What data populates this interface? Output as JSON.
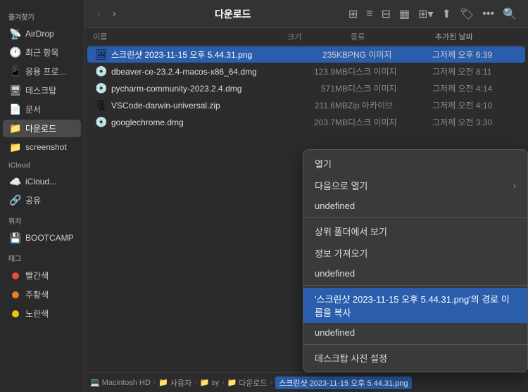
{
  "window": {
    "title": "다운로드"
  },
  "sidebar": {
    "favorites_label": "즐겨찾기",
    "items": [
      {
        "id": "airdrop",
        "label": "AirDrop",
        "icon": "📡"
      },
      {
        "id": "recent",
        "label": "최근 항목",
        "icon": "🕐"
      },
      {
        "id": "apps",
        "label": "응용 프로그램",
        "icon": "📱"
      },
      {
        "id": "desktop",
        "label": "데스크탑",
        "icon": "🖥"
      },
      {
        "id": "documents",
        "label": "문서",
        "icon": "📄"
      },
      {
        "id": "downloads",
        "label": "다운로드",
        "icon": "📁",
        "active": true
      },
      {
        "id": "screenshot",
        "label": "screenshot",
        "icon": "📁"
      }
    ],
    "icloud_label": "iCloud",
    "icloud_items": [
      {
        "id": "icloud-drive",
        "label": "iCloud...",
        "icon": "☁️"
      },
      {
        "id": "shared",
        "label": "공유",
        "icon": "🔗"
      }
    ],
    "locations_label": "위치",
    "location_items": [
      {
        "id": "bootcamp",
        "label": "BOOTCAMP",
        "icon": "💾"
      }
    ],
    "tags_label": "태그",
    "tag_items": [
      {
        "id": "red",
        "label": "빨간색",
        "color": "#e74c3c"
      },
      {
        "id": "orange",
        "label": "주황색",
        "color": "#e67e22"
      },
      {
        "id": "yellow",
        "label": "노란색",
        "color": "#f1c40f"
      }
    ]
  },
  "toolbar": {
    "title": "다운로드",
    "back_label": "‹",
    "forward_label": "›"
  },
  "columns": {
    "name": "이름",
    "size": "크기",
    "type": "종류",
    "date": "추가된 날짜"
  },
  "files": [
    {
      "name": "스크린샷 2023-11-15 오후 5.44.31.png",
      "size": "235KB",
      "type": "PNG 이미지",
      "date": "그저께 오후 6:39",
      "icon": "🖼",
      "selected": true
    },
    {
      "name": "dbeaver-ce-23.2.4-macos-x86_64.dmg",
      "size": "123.9MB",
      "type": "디스크 이미지",
      "date": "그저께 오전 8:11",
      "icon": "💿",
      "selected": false
    },
    {
      "name": "pycharm-community-2023.2.4.dmg",
      "size": "571MB",
      "type": "디스크 이미지",
      "date": "그저께 오전 4:14",
      "icon": "💿",
      "selected": false
    },
    {
      "name": "VSCode-darwin-universal.zip",
      "size": "211.6MB",
      "type": "Zip 아카이브",
      "date": "그저께 오전 4:10",
      "icon": "🗜",
      "selected": false
    },
    {
      "name": "googlechrome.dmg",
      "size": "203.7MB",
      "type": "디스크 이미지",
      "date": "그저께 오전 3:30",
      "icon": "💿",
      "selected": false
    }
  ],
  "breadcrumb": {
    "items": [
      {
        "label": "Macintosh HD",
        "icon": "💻"
      },
      {
        "label": "사용자",
        "icon": "📁"
      },
      {
        "label": "sy",
        "icon": "📁"
      },
      {
        "label": "다운로드",
        "icon": "📁"
      }
    ],
    "selected": "스크린샷 2023-11-15 오후 5.44.31.png"
  },
  "context_menu": {
    "items": [
      {
        "id": "open",
        "label": "열기",
        "has_arrow": false
      },
      {
        "id": "open-with",
        "label": "다음으로 열기",
        "has_arrow": true
      },
      {
        "separator_after": true
      },
      {
        "id": "show-in-folder",
        "label": "상위 폴더에서 보기",
        "has_arrow": false
      },
      {
        "id": "get-info",
        "label": "정보 가져오기",
        "has_arrow": false
      },
      {
        "separator_after": true
      },
      {
        "id": "copy-path",
        "label": "'스크린샷 2023-11-15 오후 5.44.31.png'의 경로 이름을 복사",
        "highlighted": true,
        "has_arrow": false
      },
      {
        "separator_after": true
      },
      {
        "id": "desktop-picture",
        "label": "데스크탑 사진 설정",
        "has_arrow": false
      }
    ]
  }
}
